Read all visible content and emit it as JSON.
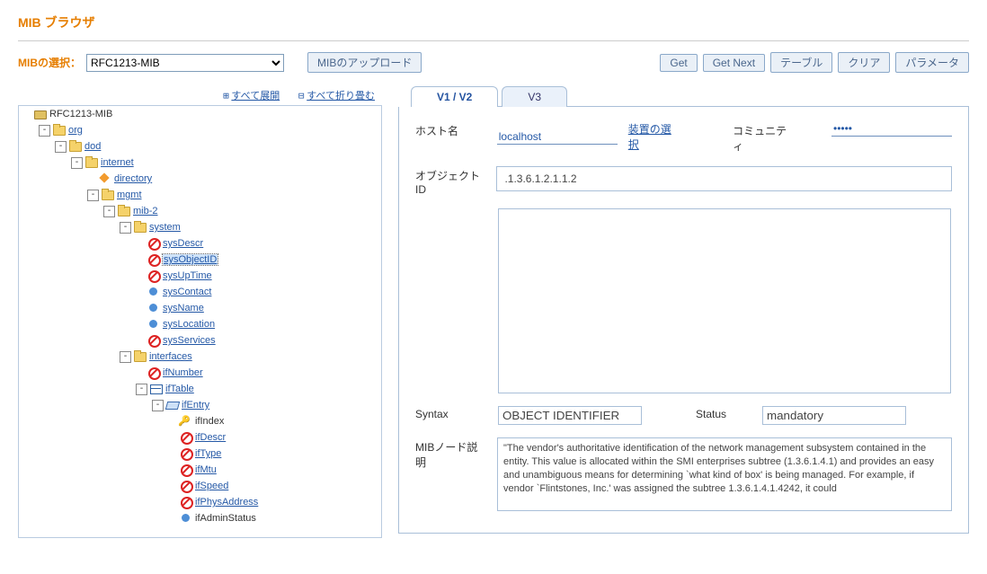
{
  "page_title": "MIB ブラウザ",
  "toolbar": {
    "select_label": "MIBの選択：",
    "select_value": "RFC1213-MIB",
    "upload_label": "MIBのアップロード",
    "get_label": "Get",
    "getnext_label": "Get Next",
    "table_label": "テーブル",
    "clear_label": "クリア",
    "param_label": "パラメータ"
  },
  "tree_toolbar": {
    "expand_all": "すべて展開",
    "collapse_all": "すべて折り畳む"
  },
  "tree": {
    "root": "RFC1213-MIB",
    "org": "org",
    "dod": "dod",
    "internet": "internet",
    "directory": "directory",
    "mgmt": "mgmt",
    "mib2": "mib-2",
    "system": "system",
    "sysDescr": "sysDescr",
    "sysObjectID": "sysObjectID",
    "sysUpTime": "sysUpTime",
    "sysContact": "sysContact",
    "sysName": "sysName",
    "sysLocation": "sysLocation",
    "sysServices": "sysServices",
    "interfaces": "interfaces",
    "ifNumber": "ifNumber",
    "ifTable": "ifTable",
    "ifEntry": "ifEntry",
    "ifIndex": "ifIndex",
    "ifDescr": "ifDescr",
    "ifType": "ifType",
    "ifMtu": "ifMtu",
    "ifSpeed": "ifSpeed",
    "ifPhysAddress": "ifPhysAddress",
    "ifAdminStatus": "ifAdminStatus"
  },
  "tabs": {
    "v12": "V1 / V2",
    "v3": "V3"
  },
  "form": {
    "host_label": "ホスト名",
    "host_value": "localhost",
    "device_select": "装置の選択",
    "community_label": "コミュニティ",
    "community_value": "•••••",
    "oid_label": "オブジェクトID",
    "oid_value": ".1.3.6.1.2.1.1.2",
    "syntax_label": "Syntax",
    "syntax_value": "OBJECT IDENTIFIER",
    "status_label": "Status",
    "status_value": "mandatory",
    "desc_label": "MIBノード説明",
    "desc_value": "\"The vendor's authoritative identification of the network management subsystem contained in the entity. This value is allocated within the SMI enterprises subtree (1.3.6.1.4.1) and provides an easy and unambiguous means for determining `what kind of box' is being managed. For example, if vendor `Flintstones, Inc.' was assigned the subtree 1.3.6.1.4.1.4242, it could"
  }
}
